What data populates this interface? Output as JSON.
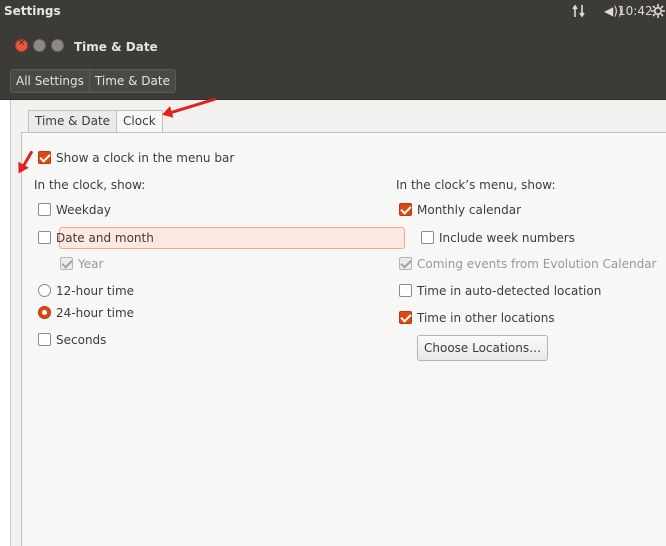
{
  "topbar": {
    "app_title": "Settings",
    "network_icon": "network-arrows-icon",
    "volume_label": "◀))",
    "time": "10:42",
    "gear_icon": "gear-icon"
  },
  "window": {
    "title": "Time & Date"
  },
  "breadcrumbs": [
    "All Settings",
    "Time & Date"
  ],
  "tabs": [
    {
      "label": "Time & Date",
      "active": false
    },
    {
      "label": "Clock",
      "active": true
    }
  ],
  "show_clock": {
    "label": "Show a clock in the menu bar",
    "checked": true
  },
  "clock_section": {
    "heading": "In the clock, show:",
    "weekday": {
      "label": "Weekday",
      "checked": false
    },
    "date_and_month": {
      "label": "Date and month",
      "checked": false
    },
    "year": {
      "label": "Year",
      "checked": true,
      "enabled": false
    },
    "hour12": {
      "label": "12-hour time",
      "selected": false
    },
    "hour24": {
      "label": "24-hour time",
      "selected": true
    },
    "seconds": {
      "label": "Seconds",
      "checked": false
    }
  },
  "menu_section": {
    "heading": "In the clock’s menu, show:",
    "monthly_calendar": {
      "label": "Monthly calendar",
      "checked": true
    },
    "week_numbers": {
      "label": "Include week numbers",
      "checked": false
    },
    "evolution_events": {
      "label": "Coming events from Evolution Calendar",
      "checked": true,
      "enabled": false
    },
    "auto_location": {
      "label": "Time in auto-detected location",
      "checked": false
    },
    "other_locations": {
      "label": "Time in other locations",
      "checked": true
    },
    "choose_button": "Choose Locations…"
  },
  "colors": {
    "accent": "#dd4814",
    "annotation_arrow": "#e0211f",
    "titlebar": "#3c3b37"
  }
}
